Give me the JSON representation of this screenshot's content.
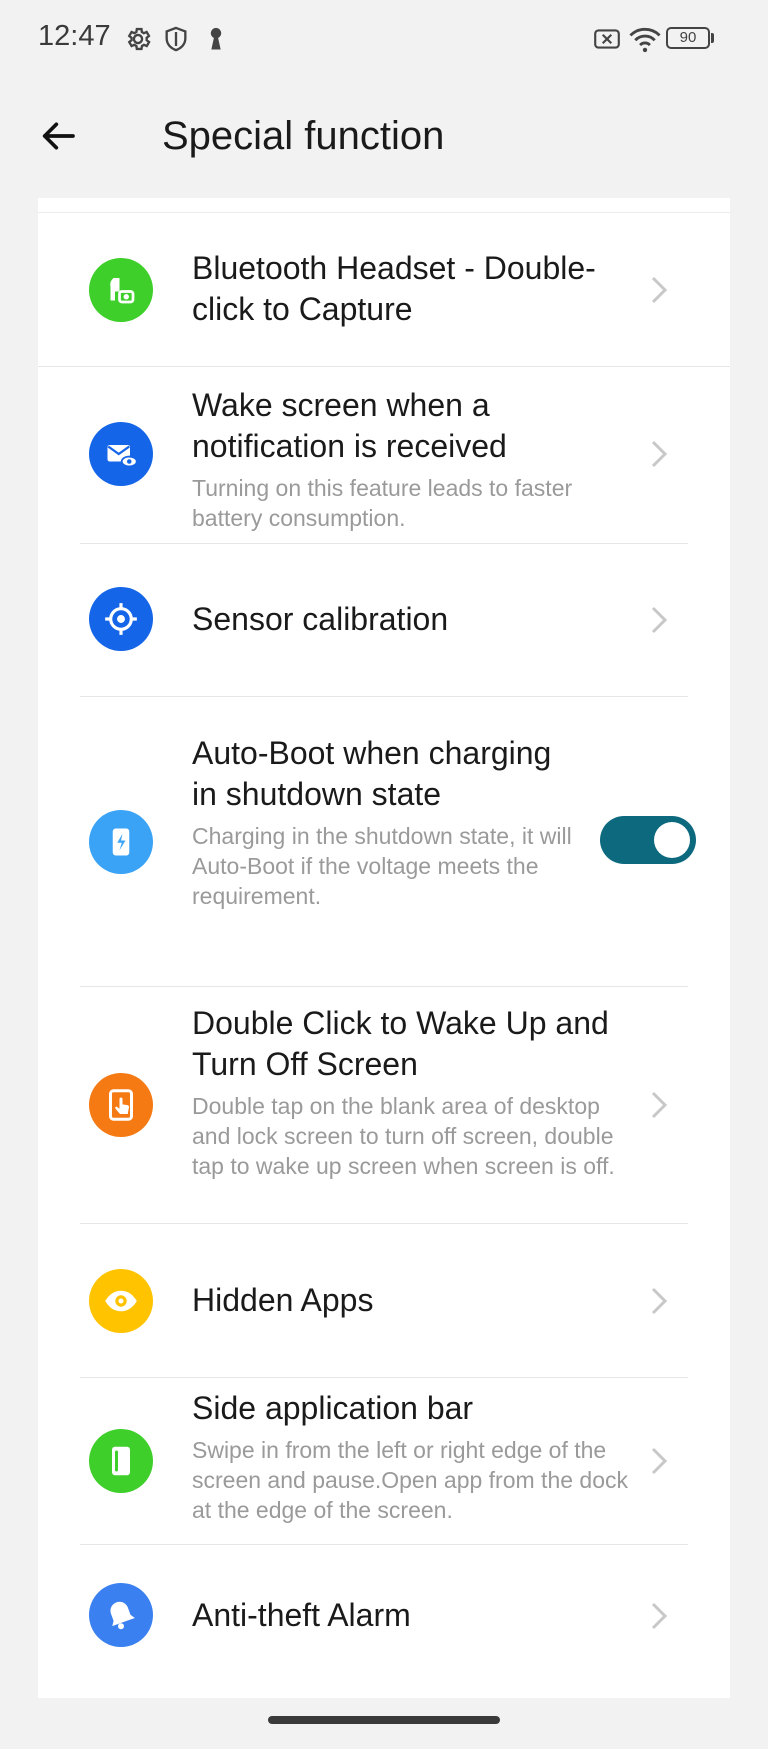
{
  "status_bar": {
    "time": "12:47",
    "battery": "90",
    "left_icons": [
      "gear-icon",
      "shield-icon",
      "keyhole-icon"
    ],
    "right_icons": [
      "no-sim-icon",
      "wifi-icon",
      "battery-icon"
    ]
  },
  "header": {
    "title": "Special function"
  },
  "items": [
    {
      "label": "Bluetooth Headset - Double-click to Capture",
      "icon": "bluetooth-headset-camera-icon",
      "icon_color": "#3ecf2a",
      "control": "chevron"
    },
    {
      "label": "Wake screen when a notification is received",
      "description": "Turning on this feature leads to faster battery consumption.",
      "icon": "mail-eye-icon",
      "icon_color": "#1565e8",
      "control": "chevron"
    },
    {
      "label": "Sensor calibration",
      "icon": "crosshair-icon",
      "icon_color": "#1565e8",
      "control": "chevron"
    },
    {
      "label": "Auto-Boot when charging in shutdown state",
      "description": "Charging in the shutdown state, it will Auto-Boot if the voltage meets the requirement.",
      "icon": "phone-charge-icon",
      "icon_color": "#3ba3f5",
      "control": "toggle",
      "toggle_on": true
    },
    {
      "label": "Double Click to Wake Up and Turn Off Screen",
      "description": "Double tap on the blank area of desktop and lock screen to turn off screen, double tap to wake up screen when screen is off.",
      "icon": "phone-tap-icon",
      "icon_color": "#f57a14",
      "control": "chevron"
    },
    {
      "label": "Hidden Apps",
      "icon": "eye-icon",
      "icon_color": "#ffc300",
      "control": "chevron"
    },
    {
      "label": "Side application bar",
      "description": "Swipe in from the left or right edge of the screen and pause.Open app from the dock at the edge of the screen.",
      "icon": "phone-sidebar-icon",
      "icon_color": "#3ecf2a",
      "control": "chevron"
    },
    {
      "label": "Anti-theft Alarm",
      "icon": "alarm-bell-icon",
      "icon_color": "#3a80f0",
      "control": "chevron"
    }
  ],
  "colors": {
    "toggle_on": "#0d6a7e",
    "background": "#f2f2f2",
    "card": "#ffffff"
  }
}
